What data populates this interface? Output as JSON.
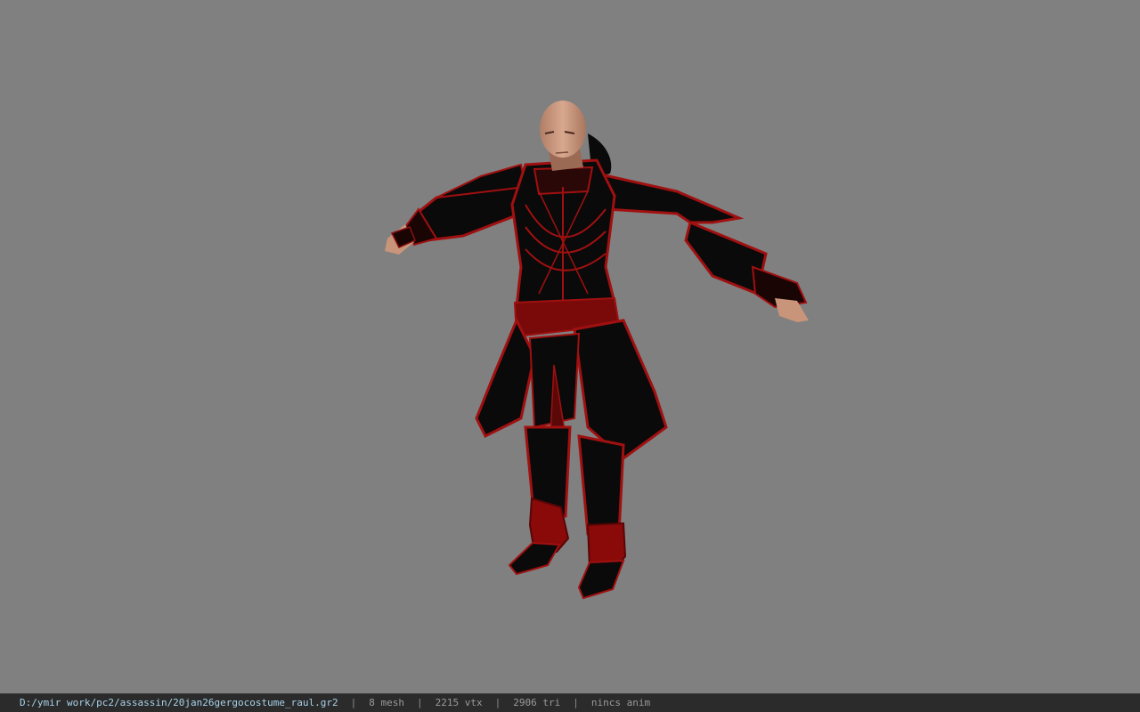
{
  "viewport": {
    "background": "#808080",
    "content": "3d-character-model-assassin-costume"
  },
  "status_bar": {
    "file_path": "D:/ymir work/pc2/assassin/20jan26gergocostume_raul.gr2",
    "separator": "|",
    "mesh": "8 mesh",
    "vertices": "2215 vtx",
    "triangles": "2906 tri",
    "animation": "nincs anim",
    "path_color": "#a8d2ea",
    "background": "#2b2b2b"
  },
  "model": {
    "primary_color": "#0a0a0a",
    "accent_color": "#a01010",
    "skin_color": "#c8957a"
  }
}
